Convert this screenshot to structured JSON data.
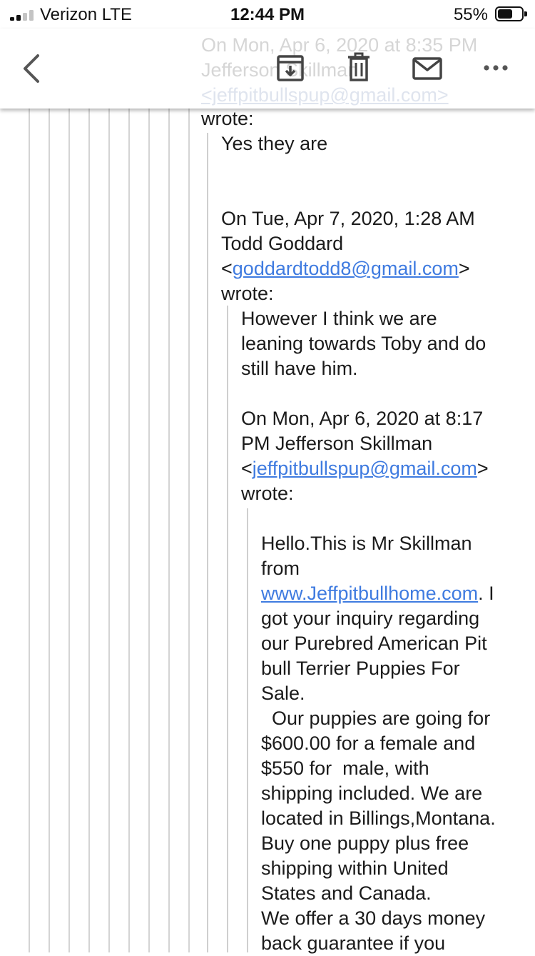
{
  "status_bar": {
    "carrier": "Verizon  LTE",
    "time": "12:44 PM",
    "battery_percent": "55%",
    "battery_level": 0.55,
    "signal_bars": 2
  },
  "toolbar": {
    "ghost_header_lines": [
      "On Mon, Apr 6, 2020 at 8:35 PM",
      "Jefferson Skillman",
      "<jeffpitbullspup@gmail.com>"
    ],
    "icons": [
      "back-chevron-icon",
      "archive-icon",
      "trash-icon",
      "mail-icon",
      "more-icon"
    ]
  },
  "email": {
    "wrote_top": "wrote:",
    "reply1": "Yes they are",
    "quote1": {
      "header_line1": "On Tue, Apr 7, 2020, 1:28 AM",
      "header_line2": "Todd Goddard",
      "lt": "<",
      "email": "goddardtodd8@gmail.com",
      "gt": ">",
      "wrote": "wrote:",
      "body_lines": [
        "However I think we are",
        "leaning towards Toby and do",
        "still have him."
      ]
    },
    "quote2": {
      "header_line1": "On Mon, Apr 6, 2020 at 8:17",
      "header_line2": "PM Jefferson Skillman",
      "lt": "<",
      "email": "jeffpitbullspup@gmail.com",
      "gt": ">",
      "wrote": "wrote:",
      "line1": "Hello.This is Mr Skillman",
      "line2": "from",
      "website": "www.Jeffpitbullhome.com",
      "after_link": ". I",
      "rest_lines": [
        "got your inquiry regarding",
        "our Purebred American Pit",
        "bull Terrier Puppies For",
        "Sale.",
        "  Our puppies are going for",
        "$600.00 for a female and",
        "$550 for  male, with",
        "shipping included. We are",
        "located in Billings,Montana.",
        "Buy one puppy plus free",
        "shipping within United",
        "States and Canada.",
        "We offer a 30 days money",
        "back guarantee if you"
      ]
    }
  }
}
